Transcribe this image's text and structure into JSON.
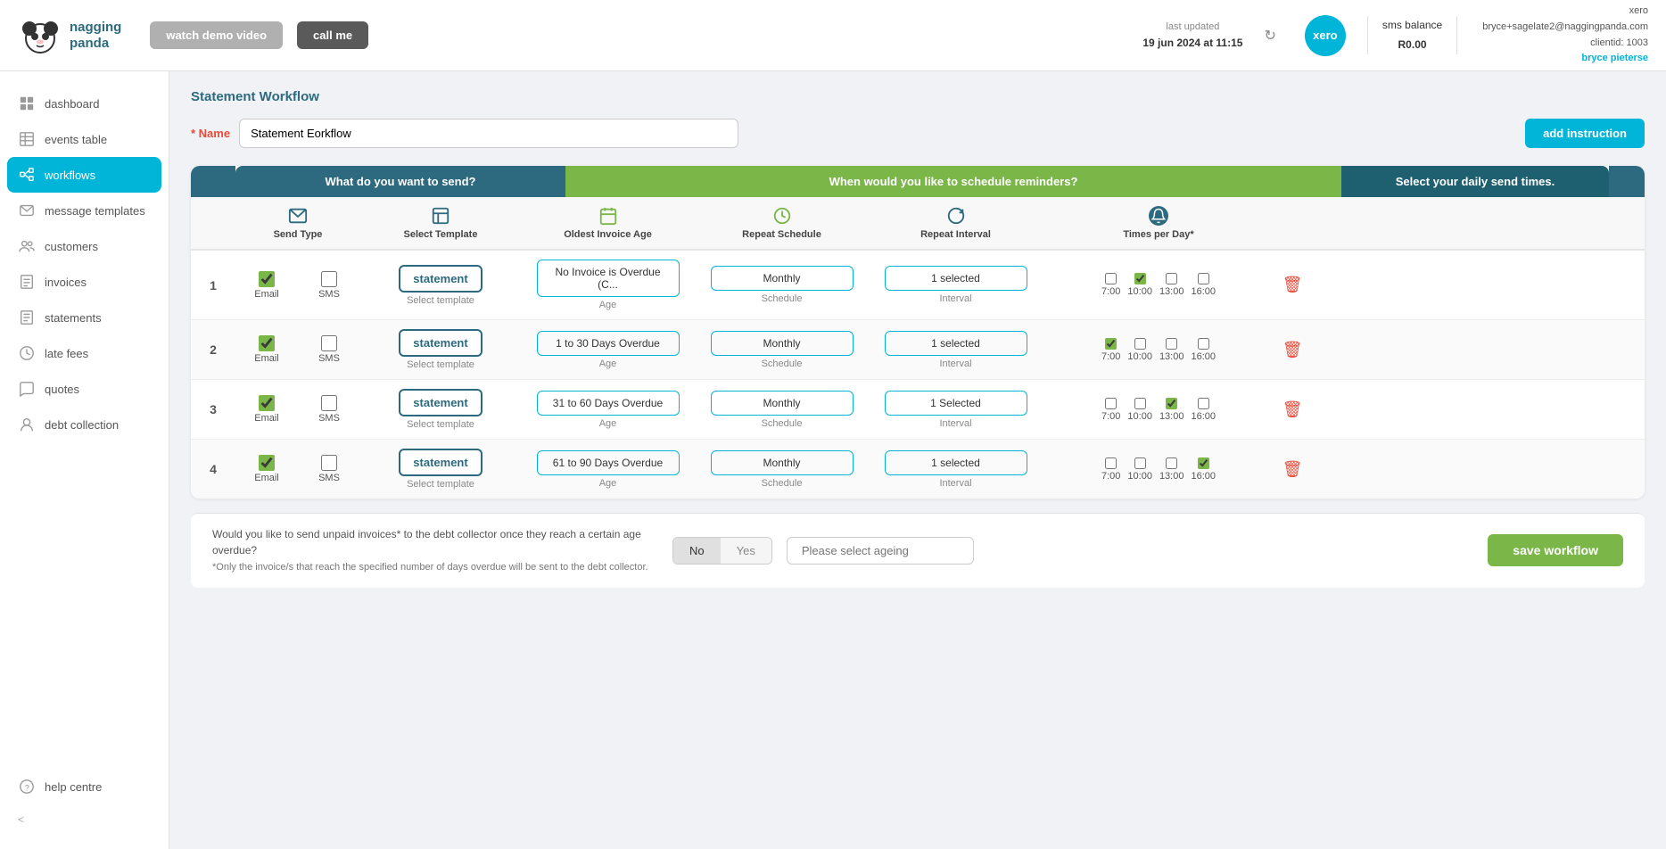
{
  "topnav": {
    "logo_text": "nagging\npanda",
    "watch_demo": "watch demo video",
    "call_me": "call me",
    "last_updated_label": "last updated",
    "last_updated_value": "19 jun 2024 at 11:15",
    "xero_label": "xero",
    "sms_balance_label": "sms balance",
    "sms_balance_value": "R0.00",
    "user_email": "bryce+sagelate2@naggingpanda.com",
    "user_client": "clientid: 1003",
    "user_name": "bryce pieterse"
  },
  "sidebar": {
    "items": [
      {
        "label": "dashboard",
        "icon": "grid-icon"
      },
      {
        "label": "events table",
        "icon": "table-icon"
      },
      {
        "label": "workflows",
        "icon": "workflow-icon",
        "active": true
      },
      {
        "label": "message templates",
        "icon": "message-icon"
      },
      {
        "label": "customers",
        "icon": "customers-icon"
      },
      {
        "label": "invoices",
        "icon": "invoice-icon"
      },
      {
        "label": "statements",
        "icon": "statements-icon"
      },
      {
        "label": "late fees",
        "icon": "latefee-icon"
      },
      {
        "label": "quotes",
        "icon": "quotes-icon"
      },
      {
        "label": "debt collection",
        "icon": "debt-icon"
      },
      {
        "label": "help centre",
        "icon": "help-icon"
      }
    ],
    "collapse_label": "<"
  },
  "page": {
    "title": "Statement Workflow",
    "name_label": "* Name",
    "name_value": "Statement Eorkflow",
    "add_instruction": "add instruction"
  },
  "table_headers": {
    "send": "What do you want to send?",
    "when": "When would you like to schedule reminders?",
    "times": "Select your daily send times."
  },
  "sub_headers": {
    "send_type": "Send Type",
    "template": "Select Template",
    "age": "Oldest Invoice Age",
    "schedule": "Repeat Schedule",
    "interval": "Repeat Interval",
    "times_per_day": "Times per Day*"
  },
  "rows": [
    {
      "num": "1",
      "email_checked": true,
      "sms_checked": false,
      "template": "statement",
      "template_sub": "Select template",
      "age": "No Invoice is Overdue (C...",
      "age_label": "Age",
      "schedule": "Monthly",
      "schedule_label": "Schedule",
      "interval": "1 selected",
      "interval_label": "Interval",
      "times": [
        "7:00",
        "10:00",
        "13:00",
        "16:00"
      ],
      "times_checked": [
        false,
        true,
        false,
        false
      ]
    },
    {
      "num": "2",
      "email_checked": true,
      "sms_checked": false,
      "template": "statement",
      "template_sub": "Select template",
      "age": "1 to 30 Days Overdue",
      "age_label": "Age",
      "schedule": "Monthly",
      "schedule_label": "Schedule",
      "interval": "1 selected",
      "interval_label": "Interval",
      "times": [
        "7:00",
        "10:00",
        "13:00",
        "16:00"
      ],
      "times_checked": [
        true,
        false,
        false,
        false
      ]
    },
    {
      "num": "3",
      "email_checked": true,
      "sms_checked": false,
      "template": "statement",
      "template_sub": "Select template",
      "age": "31 to 60 Days Overdue",
      "age_label": "Age",
      "schedule": "Monthly",
      "schedule_label": "Schedule",
      "interval": "1 Selected",
      "interval_label": "Interval",
      "times": [
        "7:00",
        "10:00",
        "13:00",
        "16:00"
      ],
      "times_checked": [
        false,
        false,
        true,
        false
      ]
    },
    {
      "num": "4",
      "email_checked": true,
      "sms_checked": false,
      "template": "statement",
      "template_sub": "Select template",
      "age": "61 to 90 Days Overdue",
      "age_label": "Age",
      "schedule": "Monthly",
      "schedule_label": "Schedule",
      "interval": "1 selected",
      "interval_label": "Interval",
      "times": [
        "7:00",
        "10:00",
        "13:00",
        "16:00"
      ],
      "times_checked": [
        false,
        false,
        false,
        true
      ]
    }
  ],
  "bottom": {
    "debt_text": "Would you like to send unpaid invoices* to the debt collector once they reach a certain age overdue?",
    "debt_sub": "*Only the invoice/s that reach the specified number of days overdue will be sent to the debt collector.",
    "no_label": "No",
    "yes_label": "Yes",
    "ageing_placeholder": "Please select ageing",
    "save_label": "save workflow"
  },
  "colors": {
    "teal_dark": "#2d6a7f",
    "green": "#7ab648",
    "cyan": "#00b5d8",
    "red": "#e74c3c"
  }
}
